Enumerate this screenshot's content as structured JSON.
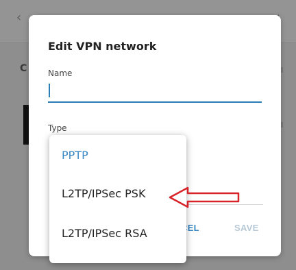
{
  "background": {
    "back_glyph": "‹",
    "right_fragment": "I",
    "side_letter": "C"
  },
  "dialog": {
    "title": "Edit VPN network",
    "name_label": "Name",
    "name_value": "",
    "type_label": "Type",
    "cancel_label": "CEL",
    "save_label": "SAVE"
  },
  "type_dropdown": {
    "selected": "PPTP",
    "options": [
      {
        "label": "PPTP"
      },
      {
        "label": "L2TP/IPSec PSK"
      },
      {
        "label": "L2TP/IPSec RSA"
      }
    ]
  },
  "annotation": {
    "arrow_color": "#d8232a",
    "points_to": "L2TP/IPSec PSK"
  },
  "colors": {
    "accent": "#3a88c4",
    "input_underline": "#2a7db5",
    "save_disabled": "#b7c9d6",
    "scrim": "#8e8e8e"
  }
}
